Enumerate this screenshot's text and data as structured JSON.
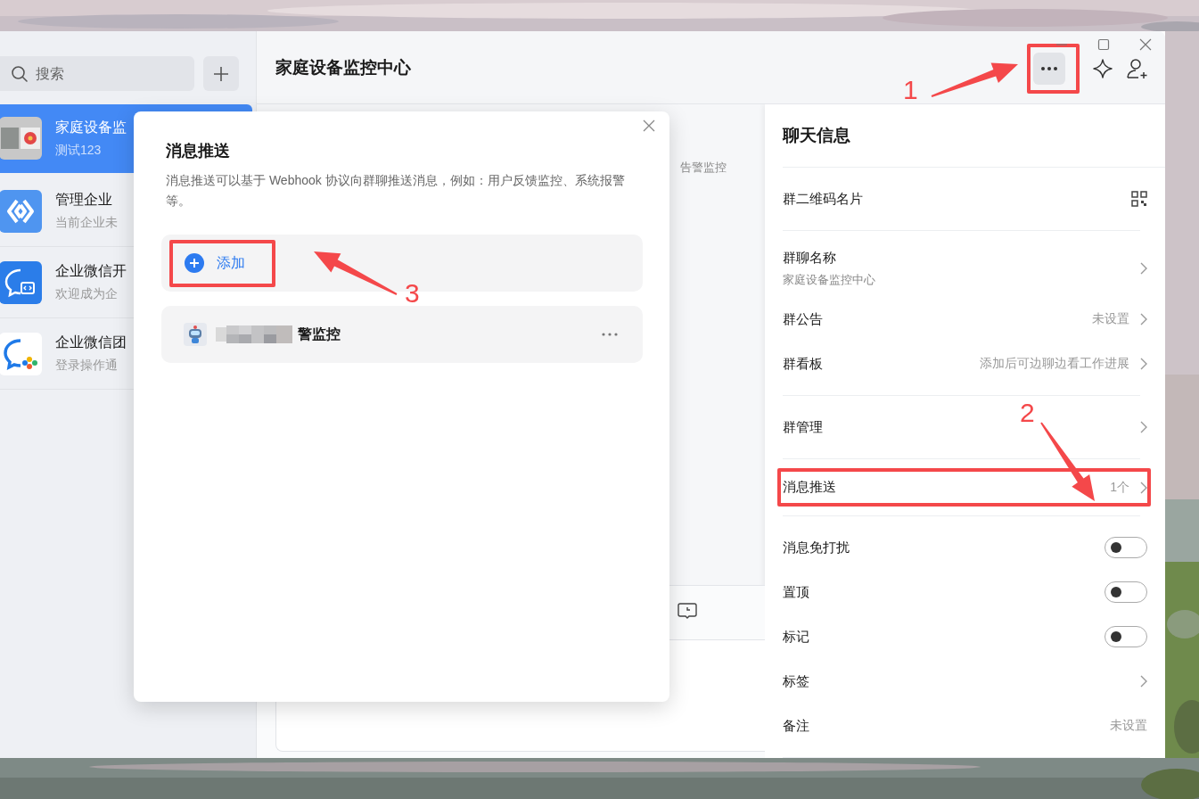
{
  "sidebar": {
    "search": {
      "placeholder": "搜索"
    },
    "chats": [
      {
        "name": "家庭设备监",
        "preview": "测试123",
        "selected": true
      },
      {
        "name": "管理企业",
        "preview": "当前企业未",
        "selected": false,
        "kind": "link"
      },
      {
        "name": "企业微信开",
        "preview": "欢迎成为企",
        "selected": false,
        "kind": "dev"
      },
      {
        "name": "企业微信团",
        "preview": "登录操作通",
        "selected": false,
        "kind": "team"
      }
    ]
  },
  "header": {
    "title": "家庭设备监控中心"
  },
  "conversation": {
    "snippet": "告警监控"
  },
  "modal": {
    "title": "消息推送",
    "description": "消息推送可以基于 Webhook 协议向群聊推送消息，例如：用户反馈监控、系统报警等。",
    "add_label": "添加",
    "webhooks": [
      {
        "name": "警监控",
        "redacted": true
      }
    ]
  },
  "chat_info": {
    "title": "聊天信息",
    "groups": [
      {
        "rows": [
          {
            "kind": "qr",
            "label": "群二维码名片"
          }
        ]
      },
      {
        "rows": [
          {
            "kind": "link",
            "label": "群聊名称",
            "subtitle": "家庭设备监控中心"
          },
          {
            "kind": "link",
            "label": "群公告",
            "value": "未设置"
          },
          {
            "kind": "link",
            "label": "群看板",
            "value": "添加后可边聊边看工作进展"
          }
        ]
      },
      {
        "rows": [
          {
            "kind": "link",
            "label": "群管理"
          }
        ]
      },
      {
        "rows": [
          {
            "kind": "link",
            "label": "消息推送",
            "value": "1个"
          }
        ]
      },
      {
        "rows": [
          {
            "kind": "toggle",
            "label": "消息免打扰",
            "on": false
          },
          {
            "kind": "toggle",
            "label": "置顶",
            "on": false
          },
          {
            "kind": "toggle",
            "label": "标记",
            "on": false
          },
          {
            "kind": "link",
            "label": "标签"
          },
          {
            "kind": "value",
            "label": "备注",
            "value": "未设置"
          }
        ]
      }
    ]
  },
  "annotations": [
    {
      "label": "1"
    },
    {
      "label": "2"
    },
    {
      "label": "3"
    }
  ]
}
